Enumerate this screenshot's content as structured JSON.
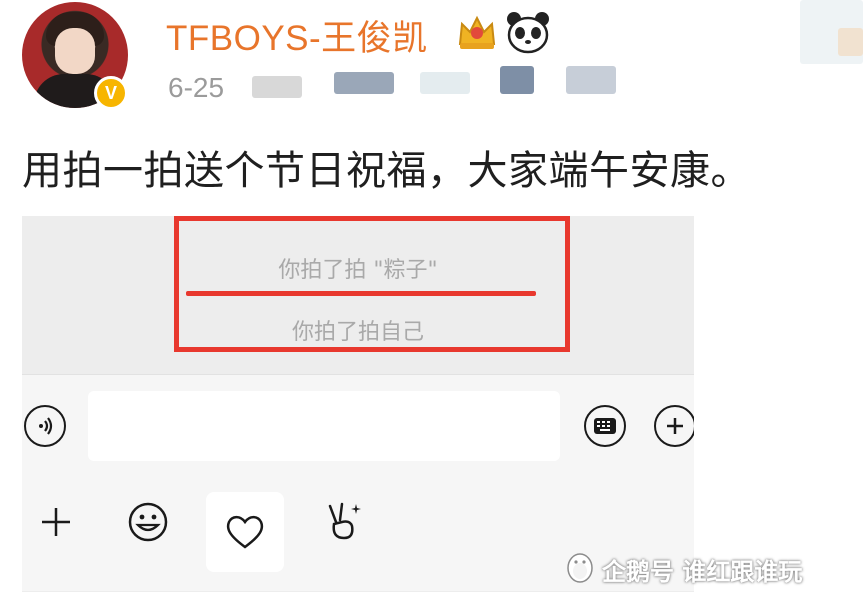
{
  "post": {
    "username": "TFBOYS-王俊凯",
    "verified_badge": "V",
    "time": "6-25",
    "content": "用拍一拍送个节日祝福，大家端午安康。"
  },
  "icons": [
    "crown-icon",
    "panda-icon",
    "voice-icon",
    "keyboard-icon",
    "add-circle-icon",
    "plus-icon",
    "emoji-icon",
    "heart-icon",
    "victory-hand-icon",
    "penguin-logo-icon"
  ],
  "chat": {
    "pat_line_1": "你拍了拍 \"粽子\"",
    "pat_line_2": "你拍了拍自己"
  },
  "colors": {
    "username": "#e8752b",
    "highlight_box": "#e8382e",
    "badge": "#f7b500"
  },
  "watermark": "企鹅号 谁红跟谁玩"
}
